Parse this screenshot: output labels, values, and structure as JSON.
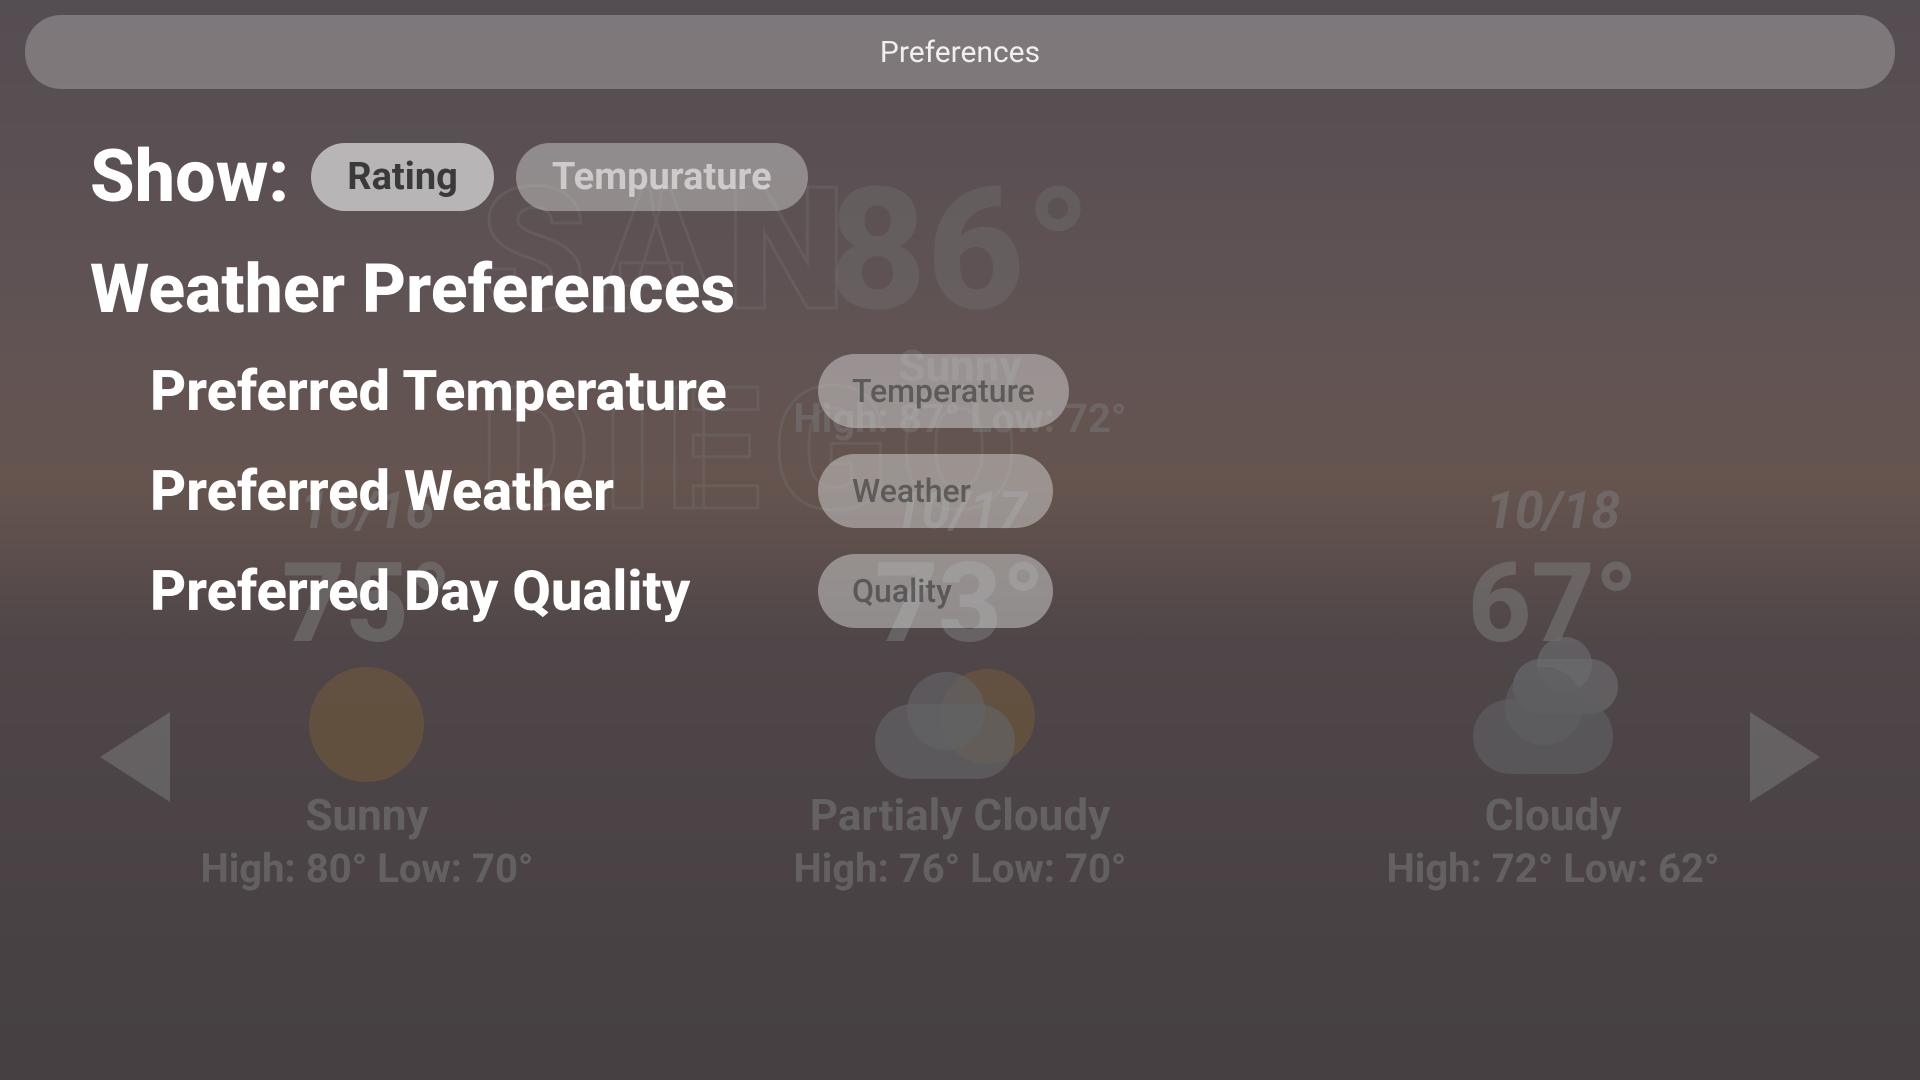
{
  "bg": {
    "city": "SAN DIEGO",
    "temp": "86°",
    "condition": "Sunny",
    "hilo": "High: 87° Low: 72°",
    "forecast": [
      {
        "date": "10/16",
        "temp": "75°",
        "condition": "Sunny",
        "hilo": "High: 80° Low: 70°"
      },
      {
        "date": "10/17",
        "temp": "73°",
        "condition": "Partialy Cloudy",
        "hilo": "High: 76° Low: 70°"
      },
      {
        "date": "10/18",
        "temp": "67°",
        "condition": "Cloudy",
        "hilo": "High: 72° Low: 62°"
      }
    ]
  },
  "prefs": {
    "title": "Preferences",
    "show_label": "Show:",
    "show_options": {
      "rating": "Rating",
      "temperature": "Tempurature"
    },
    "section_title": "Weather Preferences",
    "rows": {
      "temp": {
        "label": "Preferred Temperature",
        "placeholder": "Temperature"
      },
      "weather": {
        "label": "Preferred Weather",
        "placeholder": "Weather"
      },
      "quality": {
        "label": "Preferred Day Quality",
        "placeholder": "Quality"
      }
    }
  },
  "colors": {
    "pill_bg": "rgba(210,210,210,0.5)",
    "active_pill_bg": "rgba(220,220,220,0.72)",
    "text_primary": "#ffffff"
  }
}
